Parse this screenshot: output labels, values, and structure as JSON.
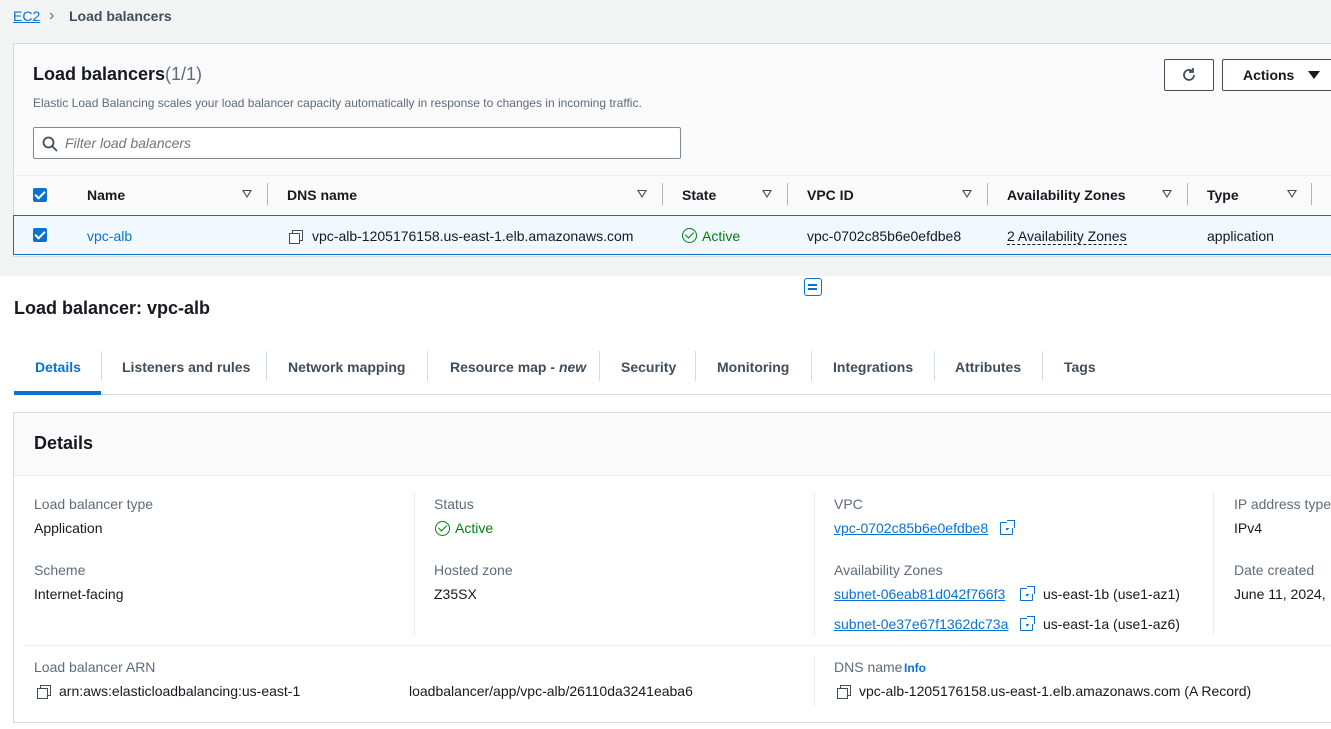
{
  "breadcrumb": {
    "root": "EC2",
    "current": "Load balancers"
  },
  "lb_list": {
    "title": "Load balancers",
    "count": "(1/1)",
    "description": "Elastic Load Balancing scales your load balancer capacity automatically in response to changes in incoming traffic.",
    "actions_label": "Actions",
    "filter_placeholder": "Filter load balancers",
    "columns": [
      "Name",
      "DNS name",
      "State",
      "VPC ID",
      "Availability Zones",
      "Type"
    ],
    "row": {
      "name": "vpc-alb",
      "dns": "vpc-alb-1205176158.us-east-1.elb.amazonaws.com",
      "state": "Active",
      "vpc": "vpc-0702c85b6e0efdbe8",
      "azs": "2 Availability Zones",
      "type": "application"
    }
  },
  "detail": {
    "title": "Load balancer: vpc-alb",
    "tabs": [
      "Details",
      "Listeners and rules",
      "Network mapping",
      "Resource map",
      "Security",
      "Monitoring",
      "Integrations",
      "Attributes",
      "Tags"
    ],
    "tab_new_suffix": "new",
    "active_tab_color": "#0972d3",
    "section_title": "Details",
    "lb_type_label": "Load balancer type",
    "lb_type": "Application",
    "status_label": "Status",
    "status": "Active",
    "vpc_label": "VPC",
    "vpc": "vpc-0702c85b6e0efdbe8",
    "ip_type_label": "IP address type",
    "ip_type": "IPv4",
    "scheme_label": "Scheme",
    "scheme": "Internet-facing",
    "hosted_zone_label": "Hosted zone",
    "hosted_zone": "Z35SX",
    "az_label": "Availability Zones",
    "subnet1": "subnet-06eab81d042f766f3",
    "subnet1_az": "us-east-1b (use1-az1)",
    "subnet2": "subnet-0e37e67f1362dc73a",
    "subnet2_az": "us-east-1a (use1-az6)",
    "date_label": "Date created",
    "date": "June 11, 2024,",
    "arn_label": "Load balancer ARN",
    "arn_part1": "arn:aws:elasticloadbalancing:us-east-1",
    "arn_part2": "loadbalancer/app/vpc-alb/26110da3241eaba6",
    "dns_label": "DNS name",
    "info_label": "Info",
    "dns_value": "vpc-alb-1205176158.us-east-1.elb.amazonaws.com (A Record)"
  },
  "colors": {
    "link": "#0972d3",
    "success": "#037f0c"
  }
}
